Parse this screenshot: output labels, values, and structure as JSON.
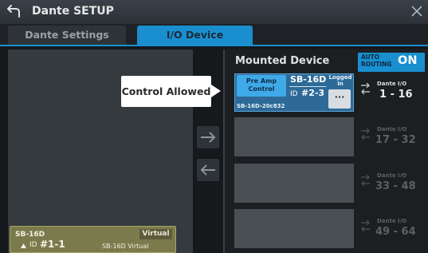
{
  "header": {
    "title": "Dante SETUP"
  },
  "tabs": [
    {
      "label": "Dante Settings",
      "active": false
    },
    {
      "label": "I/O Device",
      "active": true
    }
  ],
  "available_device": {
    "name": "SB-16D",
    "badge": "Virtual",
    "id_label": "ID",
    "id_value": "#1-1",
    "model": "SB-16D Virtual"
  },
  "callout": {
    "text": "Control Allowed"
  },
  "mounted": {
    "title": "Mounted Device",
    "auto_routing": {
      "label": "AUTO ROUTING",
      "value": "ON"
    },
    "slot1": {
      "preamp_label": "Pre Amp Control",
      "model": "SB-16D",
      "id_label": "ID",
      "id_value": "#2-3",
      "status": "Logged In",
      "more_label": "···",
      "device_name": "SB-16D-20c832"
    },
    "ranges": [
      {
        "label": "Dante I/O",
        "value": "1 - 16"
      },
      {
        "label": "Dante I/O",
        "value": "17 - 32"
      },
      {
        "label": "Dante I/O",
        "value": "33 - 48"
      },
      {
        "label": "Dante I/O",
        "value": "49 - 64"
      }
    ]
  },
  "colors": {
    "accent": "#1a8fd0",
    "virtual_card": "#7b7a4d",
    "slot_empty": "#4a4f54"
  }
}
